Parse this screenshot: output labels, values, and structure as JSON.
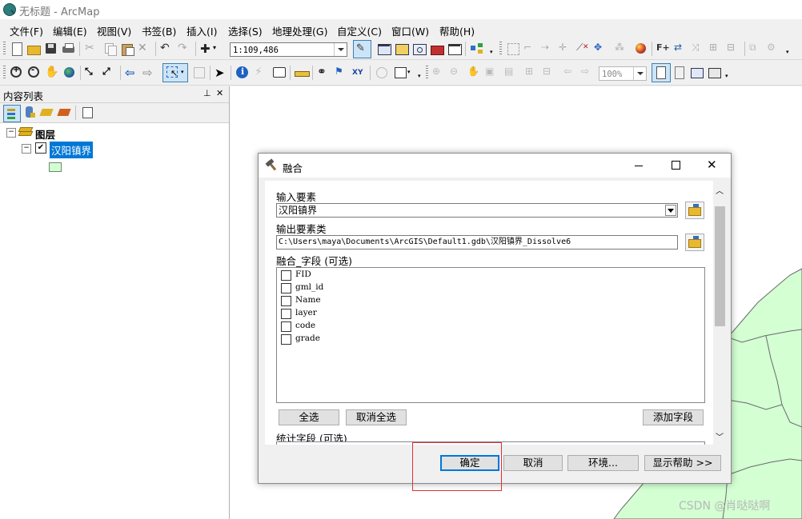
{
  "window": {
    "title": "无标题 - ArcMap"
  },
  "menu": [
    "文件(F)",
    "编辑(E)",
    "视图(V)",
    "书签(B)",
    "插入(I)",
    "选择(S)",
    "地理处理(G)",
    "自定义(C)",
    "窗口(W)",
    "帮助(H)"
  ],
  "toolbar": {
    "scale_value": "1:109,486",
    "zoom_value": "100%"
  },
  "toc": {
    "title": "内容列表",
    "pin_glyph": "⊥",
    "close_glyph": "✕",
    "root_label": "图层",
    "layer_label": "汉阳镇界",
    "expand_glyph": "⊟",
    "check_glyph": "✔"
  },
  "dialog": {
    "title": "融合",
    "input_label": "输入要素",
    "input_value": "汉阳镇界",
    "output_label": "输出要素类",
    "output_value": "C:\\Users\\maya\\Documents\\ArcGIS\\Default1.gdb\\汉阳镇界_Dissolve6",
    "dissolve_label": "融合_字段 (可选)",
    "fields": [
      "FID",
      "gml_id",
      "Name",
      "layer",
      "code",
      "grade"
    ],
    "select_all": "全选",
    "clear_all": "取消全选",
    "add_field": "添加字段",
    "stats_label": "统计字段 (可选)",
    "ok": "确定",
    "cancel": "取消",
    "env": "环境...",
    "help": "显示帮助 >>"
  },
  "watermark": "CSDN @肖哒哒啊",
  "colors": {
    "accent": "#0078d7",
    "map_fill": "#d3ffd3",
    "highlight": "#e03030",
    "selected_layer": "#0078d7"
  }
}
